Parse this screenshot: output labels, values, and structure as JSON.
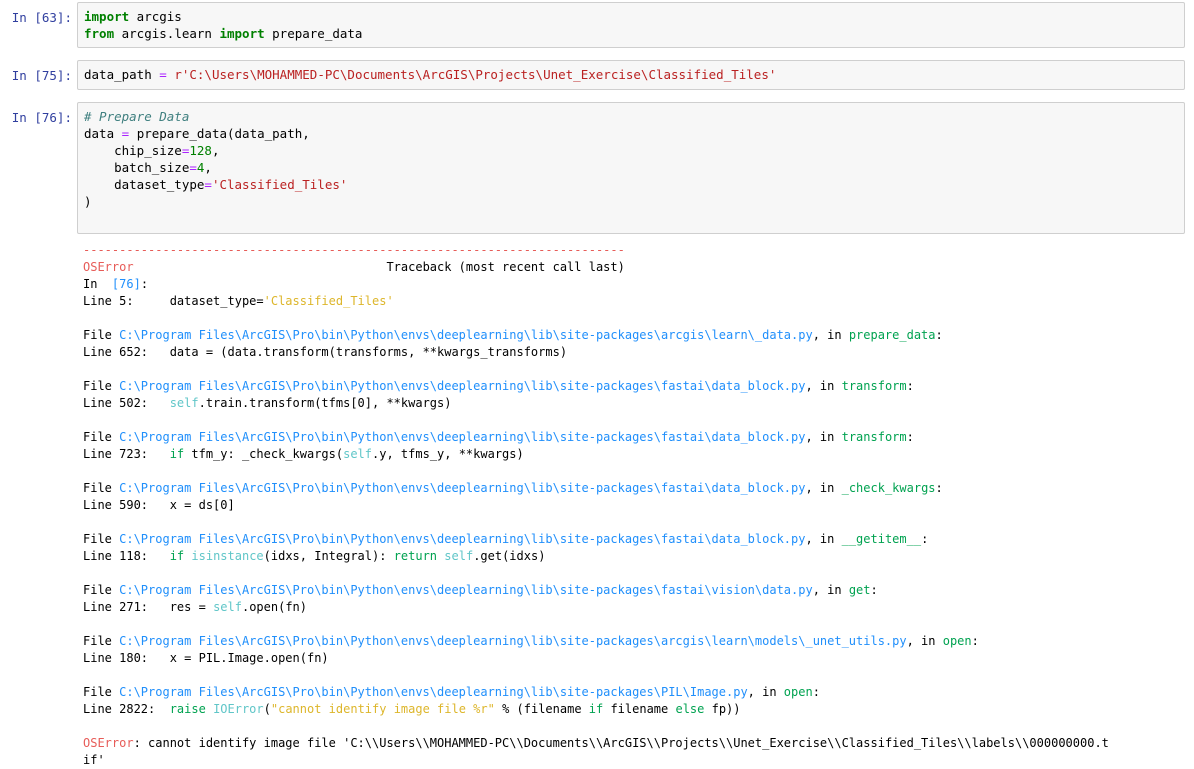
{
  "cells": [
    {
      "prompt": "In [63]:",
      "lines": [
        [
          [
            "kw",
            "import"
          ],
          [
            "t",
            " arcgis"
          ]
        ],
        [
          [
            "kw",
            "from"
          ],
          [
            "t",
            " arcgis.learn "
          ],
          [
            "kw",
            "import"
          ],
          [
            "t",
            " prepare_data"
          ]
        ]
      ]
    },
    {
      "prompt": "In [75]:",
      "lines": [
        [
          [
            "t",
            "data_path "
          ],
          [
            "op",
            "="
          ],
          [
            "t",
            " "
          ],
          [
            "str",
            "r'C:\\Users\\MOHAMMED-PC\\Documents\\ArcGIS\\Projects\\Unet_Exercise\\Classified_Tiles'"
          ]
        ]
      ]
    },
    {
      "prompt": "In [76]:",
      "lines": [
        [
          [
            "comment",
            "# Prepare Data"
          ]
        ],
        [
          [
            "t",
            "data "
          ],
          [
            "op",
            "="
          ],
          [
            "t",
            " prepare_data(data_path,"
          ]
        ],
        [
          [
            "t",
            "    chip_size"
          ],
          [
            "op",
            "="
          ],
          [
            "num",
            "128"
          ],
          [
            "t",
            ","
          ]
        ],
        [
          [
            "t",
            "    batch_size"
          ],
          [
            "op",
            "="
          ],
          [
            "num",
            "4"
          ],
          [
            "t",
            ","
          ]
        ],
        [
          [
            "t",
            "    dataset_type"
          ],
          [
            "op",
            "="
          ],
          [
            "str",
            "'Classified_Tiles'"
          ]
        ],
        [
          [
            "t",
            ")"
          ]
        ],
        [
          [
            "t",
            ""
          ]
        ]
      ]
    }
  ],
  "traceback": {
    "dashes": "---------------------------------------------------------------------------",
    "error_name": "OSError",
    "header_right": "                                   Traceback (most recent call last)",
    "in_label": "In  ",
    "in_ref": "[76]",
    "in_colon": ":",
    "first_line_label": "Line 5:     ",
    "first_line_code": "dataset_type=",
    "first_line_str": "'Classified_Tiles'",
    "frames": [
      {
        "file_label": "File ",
        "path": "C:\\Program Files\\ArcGIS\\Pro\\bin\\Python\\envs\\deeplearning\\lib\\site-packages\\arcgis\\learn\\_data.py",
        "in_word": ", in ",
        "func": "prepare_data",
        "colon": ":",
        "line_label": "Line 652:   ",
        "code": [
          [
            "t",
            "data = (data.transform(transforms, **kwargs_transforms)"
          ]
        ]
      },
      {
        "file_label": "File ",
        "path": "C:\\Program Files\\ArcGIS\\Pro\\bin\\Python\\envs\\deeplearning\\lib\\site-packages\\fastai\\data_block.py",
        "in_word": ", in ",
        "func": "transform",
        "colon": ":",
        "line_label": "Line 502:   ",
        "code": [
          [
            "cyan",
            "self"
          ],
          [
            "t",
            ".train.transform(tfms[0], **kwargs)"
          ]
        ]
      },
      {
        "file_label": "File ",
        "path": "C:\\Program Files\\ArcGIS\\Pro\\bin\\Python\\envs\\deeplearning\\lib\\site-packages\\fastai\\data_block.py",
        "in_word": ", in ",
        "func": "transform",
        "colon": ":",
        "line_label": "Line 723:   ",
        "code": [
          [
            "green",
            "if"
          ],
          [
            "t",
            " tfm_y: _check_kwargs("
          ],
          [
            "cyan",
            "self"
          ],
          [
            "t",
            ".y, tfms_y, **kwargs)"
          ]
        ]
      },
      {
        "file_label": "File ",
        "path": "C:\\Program Files\\ArcGIS\\Pro\\bin\\Python\\envs\\deeplearning\\lib\\site-packages\\fastai\\data_block.py",
        "in_word": ", in ",
        "func": "_check_kwargs",
        "colon": ":",
        "line_label": "Line 590:   ",
        "code": [
          [
            "t",
            "x = ds[0]"
          ]
        ]
      },
      {
        "file_label": "File ",
        "path": "C:\\Program Files\\ArcGIS\\Pro\\bin\\Python\\envs\\deeplearning\\lib\\site-packages\\fastai\\data_block.py",
        "in_word": ", in ",
        "func": "__getitem__",
        "colon": ":",
        "line_label": "Line 118:   ",
        "code": [
          [
            "green",
            "if"
          ],
          [
            "t",
            " "
          ],
          [
            "cyan",
            "isinstance"
          ],
          [
            "t",
            "(idxs, Integral): "
          ],
          [
            "green",
            "return"
          ],
          [
            "t",
            " "
          ],
          [
            "cyan",
            "self"
          ],
          [
            "t",
            ".get(idxs)"
          ]
        ]
      },
      {
        "file_label": "File ",
        "path": "C:\\Program Files\\ArcGIS\\Pro\\bin\\Python\\envs\\deeplearning\\lib\\site-packages\\fastai\\vision\\data.py",
        "in_word": ", in ",
        "func": "get",
        "colon": ":",
        "line_label": "Line 271:   ",
        "code": [
          [
            "t",
            "res = "
          ],
          [
            "cyan",
            "self"
          ],
          [
            "t",
            ".open(fn)"
          ]
        ]
      },
      {
        "file_label": "File ",
        "path": "C:\\Program Files\\ArcGIS\\Pro\\bin\\Python\\envs\\deeplearning\\lib\\site-packages\\arcgis\\learn\\models\\_unet_utils.py",
        "in_word": ", in ",
        "func": "open",
        "colon": ":",
        "line_label": "Line 180:   ",
        "code": [
          [
            "t",
            "x = PIL.Image.open(fn)"
          ]
        ]
      },
      {
        "file_label": "File ",
        "path": "C:\\Program Files\\ArcGIS\\Pro\\bin\\Python\\envs\\deeplearning\\lib\\site-packages\\PIL\\Image.py",
        "in_word": ", in ",
        "func": "open",
        "colon": ":",
        "line_label": "Line 2822:  ",
        "code": [
          [
            "green",
            "raise"
          ],
          [
            "t",
            " "
          ],
          [
            "cyan",
            "IOError"
          ],
          [
            "t",
            "("
          ],
          [
            "yellow",
            "\"cannot identify image file %r\""
          ],
          [
            "t",
            " % (filename "
          ],
          [
            "green",
            "if"
          ],
          [
            "t",
            " filename "
          ],
          [
            "green",
            "else"
          ],
          [
            "t",
            " fp))"
          ]
        ]
      }
    ],
    "final_error_name": "OSError",
    "final_message_1": ": cannot identify image file 'C:\\\\Users\\\\MOHAMMED-PC\\\\Documents\\\\ArcGIS\\\\Projects\\\\Unet_Exercise\\\\Classified_Tiles\\\\labels\\\\000000000.t",
    "final_message_2": "if'"
  }
}
